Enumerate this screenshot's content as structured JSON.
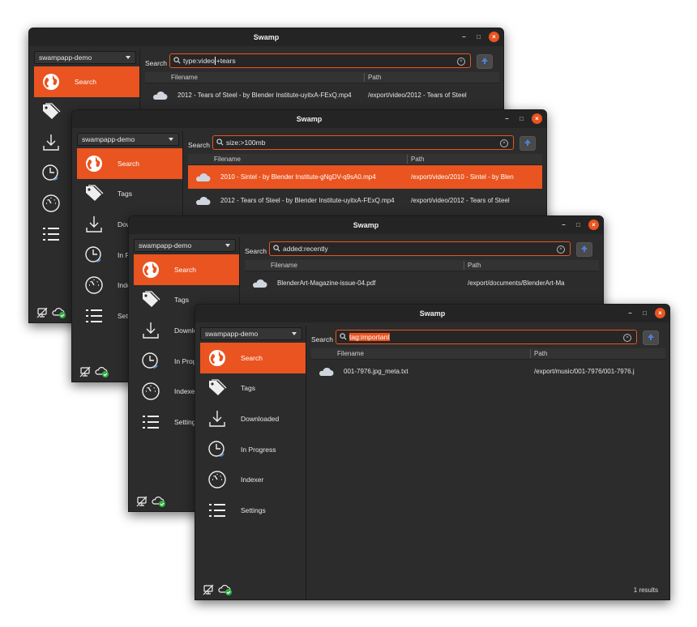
{
  "windows": [
    {
      "id": "w1",
      "title": "Swamp",
      "account": "swampapp-demo",
      "search_label": "Search",
      "query": "type:video",
      "query_after_cursor": " +tears",
      "columns": {
        "filename": "Filename",
        "path": "Path"
      },
      "nav": [
        {
          "label": "Search",
          "icon": "globe-icon",
          "active": true
        },
        {
          "label": "Tags",
          "icon": "tags-icon"
        },
        {
          "label": "Downloaded",
          "icon": "download-icon"
        },
        {
          "label": "In Progress",
          "icon": "clock-icon"
        },
        {
          "label": "Indexer",
          "icon": "gauge-icon"
        },
        {
          "label": "Settings",
          "icon": "list-icon"
        }
      ],
      "rows": [
        {
          "filename": "2012 - Tears of Steel - by Blender Institute-uyitxA-FExQ.mp4",
          "path": "/export/video/2012 - Tears of Steel"
        }
      ],
      "results": ""
    },
    {
      "id": "w2",
      "title": "Swamp",
      "account": "swampapp-demo",
      "search_label": "Search",
      "query": "size:>100mb",
      "columns": {
        "filename": "Filename",
        "path": "Path"
      },
      "nav": [
        {
          "label": "Search",
          "icon": "globe-icon",
          "active": true
        },
        {
          "label": "Tags",
          "icon": "tags-icon"
        },
        {
          "label": "Downloaded",
          "icon": "download-icon"
        },
        {
          "label": "In Progress",
          "icon": "clock-icon"
        },
        {
          "label": "Indexer",
          "icon": "gauge-icon"
        },
        {
          "label": "Settings",
          "icon": "list-icon"
        }
      ],
      "rows": [
        {
          "filename": "2010 - Sintel - by Blender Institute-gNgDV-q9sA0.mp4",
          "path": "/export/video/2010 - Sintel - by Blen",
          "selected": true
        },
        {
          "filename": "2012 - Tears of Steel - by Blender Institute-uyitxA-FExQ.mp4",
          "path": "/export/video/2012 - Tears of Steel"
        }
      ],
      "results": ""
    },
    {
      "id": "w3",
      "title": "Swamp",
      "account": "swampapp-demo",
      "search_label": "Search",
      "query": "added:recently",
      "columns": {
        "filename": "Filename",
        "path": "Path"
      },
      "nav": [
        {
          "label": "Search",
          "icon": "globe-icon",
          "active": true
        },
        {
          "label": "Tags",
          "icon": "tags-icon"
        },
        {
          "label": "Downloaded",
          "icon": "download-icon"
        },
        {
          "label": "In Progress",
          "icon": "clock-icon"
        },
        {
          "label": "Indexer",
          "icon": "gauge-icon"
        },
        {
          "label": "Settings",
          "icon": "list-icon"
        }
      ],
      "rows": [
        {
          "filename": "BlenderArt-Magazine-issue-04.pdf",
          "path": "/export/documents/BlenderArt-Ma"
        }
      ],
      "results": ""
    },
    {
      "id": "w4",
      "title": "Swamp",
      "account": "swampapp-demo",
      "search_label": "Search",
      "query": "tag:important",
      "query_selected": true,
      "columns": {
        "filename": "Filename",
        "path": "Path"
      },
      "nav": [
        {
          "label": "Search",
          "icon": "globe-icon",
          "active": true
        },
        {
          "label": "Tags",
          "icon": "tags-icon"
        },
        {
          "label": "Downloaded",
          "icon": "download-icon"
        },
        {
          "label": "In Progress",
          "icon": "clock-icon"
        },
        {
          "label": "Indexer",
          "icon": "gauge-icon"
        },
        {
          "label": "Settings",
          "icon": "list-icon"
        }
      ],
      "rows": [
        {
          "filename": "001-7976.jpg_meta.txt",
          "path": "/export/music/001-7976/001-7976.j"
        }
      ],
      "results": "1 results"
    }
  ],
  "colors": {
    "accent": "#e95420",
    "window_bg": "#2c2c2c",
    "titlebar": "#242424"
  }
}
